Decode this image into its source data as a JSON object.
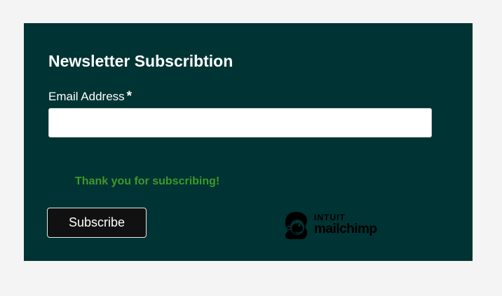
{
  "form": {
    "title": "Newsletter Subscribtion",
    "email_label": "Email Address",
    "required_marker": "*",
    "email_value": "",
    "success_message": "Thank you for subscribing!",
    "subscribe_label": "Subscribe"
  },
  "brand": {
    "line1": "INTUIT",
    "line2": "mailchimp",
    "logo_icon": "mailchimp-freddie-icon"
  },
  "colors": {
    "page_background": "#f4f4f4",
    "panel_background": "#003333",
    "success_text": "#3e9927",
    "button_background": "#111111"
  }
}
